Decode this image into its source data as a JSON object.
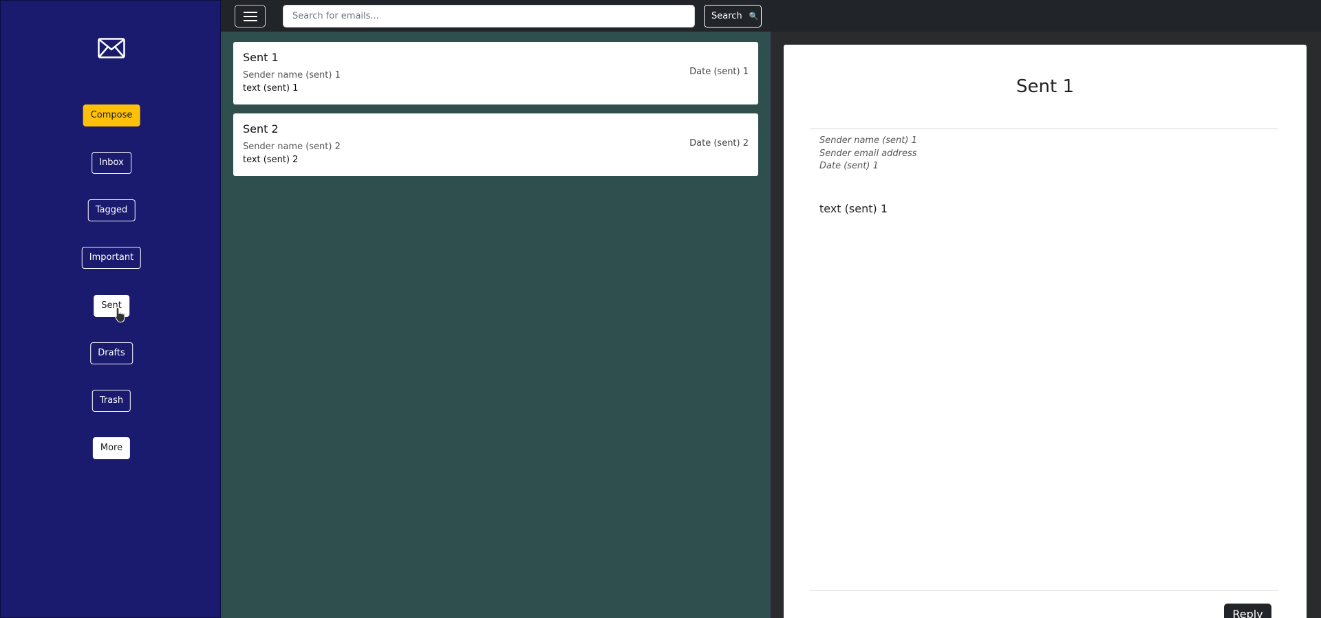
{
  "sidebar": {
    "logo_icon": "envelope-icon",
    "nav": {
      "compose": "Compose",
      "inbox": "Inbox",
      "tagged": "Tagged",
      "important": "Important",
      "sent": "Sent",
      "drafts": "Drafts",
      "trash": "Trash",
      "more": "More"
    },
    "active_item": "Sent"
  },
  "topbar": {
    "menu_icon": "hamburger-icon",
    "search_placeholder": "Search for emails...",
    "search_label": "Search",
    "search_icon": "🔍"
  },
  "email_list": [
    {
      "subject": "Sent 1",
      "sender": "Sender name (sent) 1",
      "preview": "text (sent) 1",
      "date": "Date (sent) 1"
    },
    {
      "subject": "Sent 2",
      "sender": "Sender name (sent) 2",
      "preview": "text (sent) 2",
      "date": "Date (sent) 2"
    }
  ],
  "detail": {
    "title": "Sent 1",
    "sender_name": "Sender name (sent) 1",
    "sender_email": "Sender email address",
    "date": "Date (sent) 1",
    "body": "text (sent) 1",
    "reply_label": "Reply"
  },
  "colors": {
    "sidebar_bg": "#1a1a6e",
    "list_bg": "#2f4f4f",
    "topbar_bg": "#212529",
    "compose_accent": "#ffc107"
  }
}
